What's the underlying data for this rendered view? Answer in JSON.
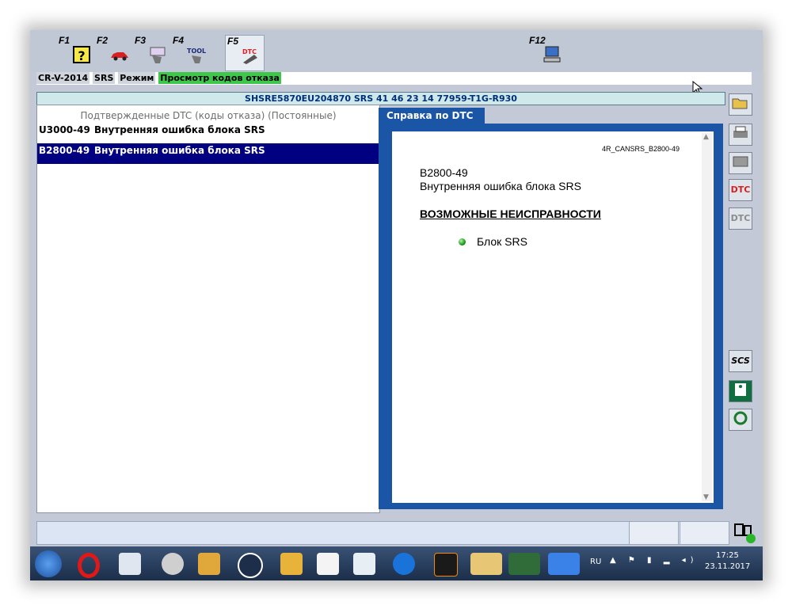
{
  "fkeys": [
    {
      "label": "F1",
      "icon": "help-icon"
    },
    {
      "label": "F2",
      "icon": "car-icon"
    },
    {
      "label": "F3",
      "icon": "tool-hand-icon"
    },
    {
      "label": "F4",
      "icon": "tool-icon"
    },
    {
      "label": "F5",
      "icon": "dtc-icon",
      "icon_text": "DTC"
    },
    {
      "label": "F12",
      "icon": "computer-icon"
    }
  ],
  "mode_bar": {
    "model": "CR-V-2014",
    "system": "SRS",
    "mode_label": "Режим",
    "view": "Просмотр кодов отказа"
  },
  "vin_bar": "SHSRE5870EU204870  SRS  41 46 23 14  77959-T1G-R930",
  "dtc_list": {
    "header": "Подтвержденные DTC (коды отказа) (Постоянные)",
    "rows": [
      {
        "code": "U3000-49",
        "description": "Внутренняя ошибка блока SRS",
        "selected": false
      },
      {
        "code": "B2800-49",
        "description": "Внутренняя ошибка блока SRS",
        "selected": true
      }
    ]
  },
  "help": {
    "tab_label": "Справка по DTC",
    "doc_id": "4R_CANSRS_B2800-49",
    "code": "B2800-49",
    "description": "Внутренняя ошибка блока SRS",
    "heading": "ВОЗМОЖНЫЕ НЕИСПРАВНОСТИ",
    "items": [
      "Блок SRS"
    ]
  },
  "side_buttons": {
    "dtc": "DTC",
    "dtc2": "DTC",
    "scs": "SCS"
  },
  "taskbar": {
    "lang": "RU",
    "time": "17:25",
    "date": "23.11.2017"
  },
  "colors": {
    "selection": "#000080",
    "help_frame": "#1a55a6",
    "mode_view": "#3ec74a"
  }
}
